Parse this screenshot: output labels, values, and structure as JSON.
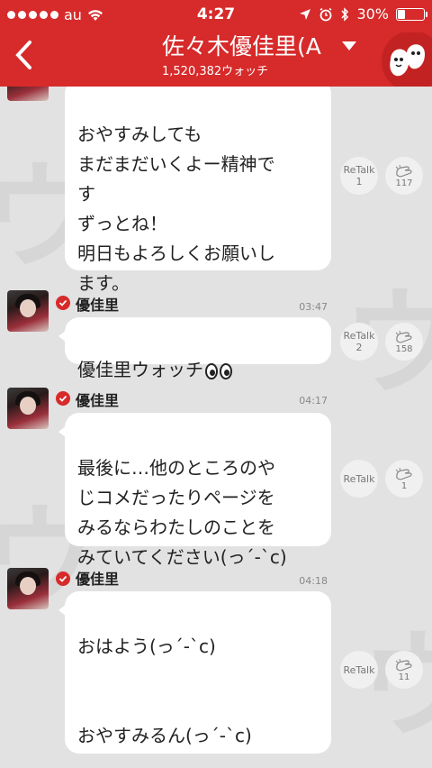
{
  "status": {
    "carrier": "au",
    "time": "4:27",
    "battery_text": "30%",
    "battery_level": 0.3
  },
  "header": {
    "title": "佐々木優佳里(A",
    "watch_count": "1,520,382ウォッチ"
  },
  "messages": [
    {
      "sender": "",
      "time": "",
      "text": "おやすみしても\nまだまだいくよー精神で\nす\nずっとね！\n明日もよろしくお願いし\nます。",
      "retalk_label": "ReTalk",
      "retalk_count": "1",
      "clap_count": "117"
    },
    {
      "sender": "優佳里",
      "time": "03:47",
      "text": "優佳里ウォッチ",
      "retalk_label": "ReTalk",
      "retalk_count": "2",
      "clap_count": "158"
    },
    {
      "sender": "優佳里",
      "time": "04:17",
      "text": "最後に…他のところのや\nじコメだったりページを\nみるならわたしのことを\nみていてください(っ´-`c)",
      "retalk_label": "ReTalk",
      "retalk_count": "",
      "clap_count": "1"
    },
    {
      "sender": "優佳里",
      "time": "04:18",
      "text": "おはよう(っ´-`c)\n\n\nおやすみるん(っ´-`c)",
      "retalk_label": "ReTalk",
      "retalk_count": "",
      "clap_count": "11"
    }
  ],
  "colors": {
    "accent": "#d72a2a",
    "background": "#e2e2e2",
    "bubble": "#ffffff"
  }
}
